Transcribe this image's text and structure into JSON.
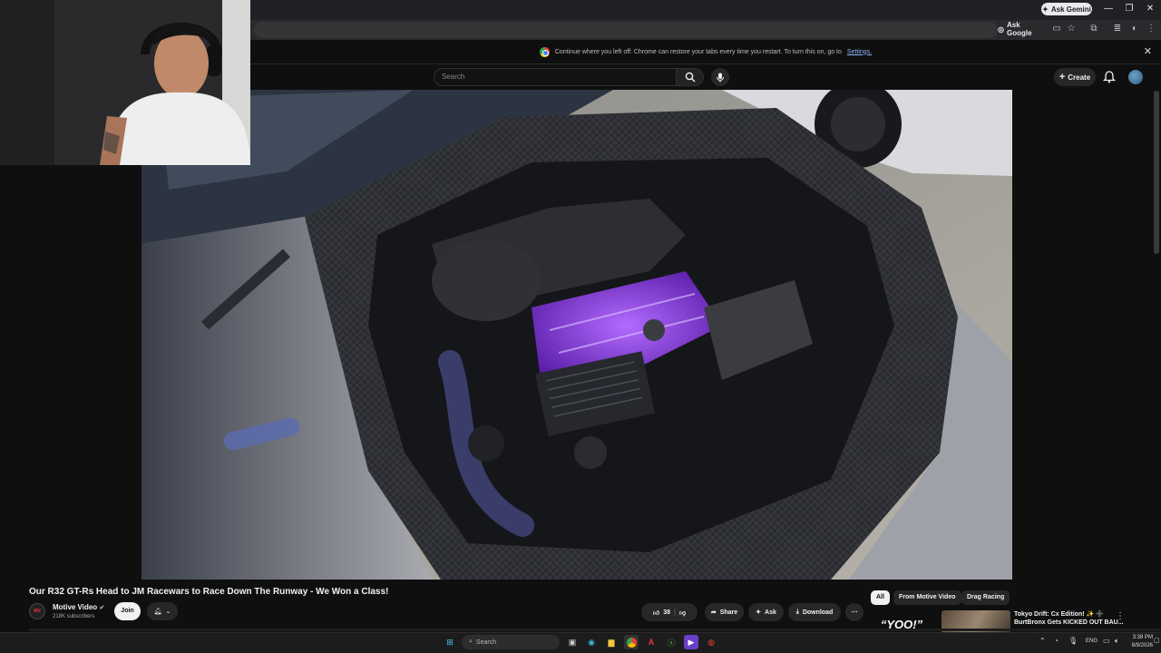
{
  "browser": {
    "ask_gemini": "Ask Gemini",
    "ask_google": "Ask Google"
  },
  "restore_banner": {
    "message": "Continue where you left off: Chrome can restore your tabs every time you restart. To turn this on, go to",
    "link": "Settings."
  },
  "youtube": {
    "search_placeholder": "Search",
    "create_label": "Create"
  },
  "video": {
    "title": "Our R32 GT-Rs Head to JM Racewars to Race Down The Runway - We Won a Class!",
    "channel_name": "Motive Video",
    "subscribers": "218K subscribers",
    "join_label": "Join",
    "likes": "38",
    "share_label": "Share",
    "ask_label": "Ask",
    "download_label": "Download"
  },
  "recommendations": {
    "chips": [
      "All",
      "From Motive Video",
      "Drag Racing"
    ],
    "thumb_text": "“YOO!”",
    "title_line1": "Tokyo Drift: Cx Edition! ✨ ➕",
    "title_line2": "BurtBronx Gets KICKED OUT BAU..."
  },
  "taskbar": {
    "search_placeholder": "Search",
    "language": "ENG",
    "time": "3:38 PM",
    "date": "8/9/2026"
  },
  "colors": {
    "accent_purple": "#8b3fd9",
    "link_blue": "#8ab4f8"
  }
}
